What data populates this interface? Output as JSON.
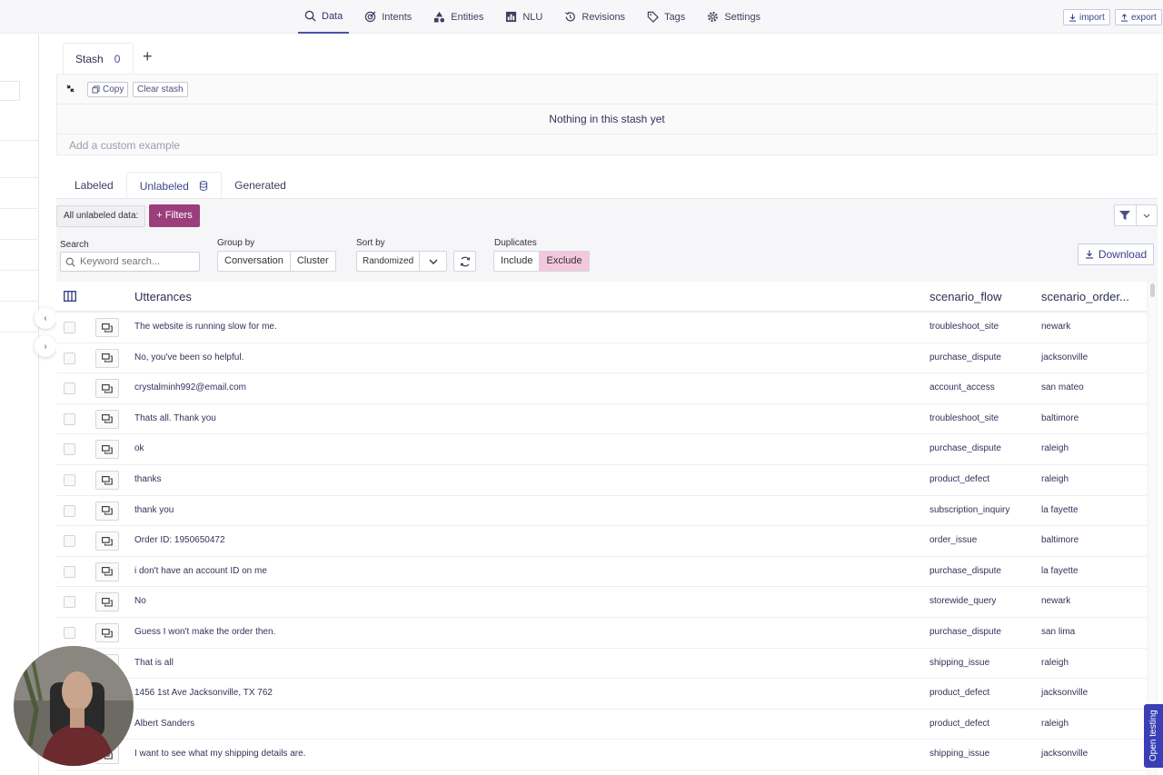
{
  "nav": {
    "items": [
      {
        "label": "Data",
        "icon": "search-icon",
        "active": true
      },
      {
        "label": "Intents",
        "icon": "target-icon"
      },
      {
        "label": "Entities",
        "icon": "shapes-icon"
      },
      {
        "label": "NLU",
        "icon": "bar-chart-icon"
      },
      {
        "label": "Revisions",
        "icon": "history-icon"
      },
      {
        "label": "Tags",
        "icon": "tag-icon"
      },
      {
        "label": "Settings",
        "icon": "gear-icon"
      }
    ],
    "import_label": "import",
    "export_label": "export"
  },
  "stash": {
    "tab_label": "Stash",
    "count": "0",
    "copy_label": "Copy",
    "clear_label": "Clear stash",
    "empty_text": "Nothing in this stash yet",
    "custom_placeholder": "Add a custom example"
  },
  "data_tabs": {
    "labeled": "Labeled",
    "unlabeled": "Unlabeled",
    "generated": "Generated"
  },
  "toolbar": {
    "all_data_label": "All unlabeled data:",
    "filters_label": "+ Filters",
    "search_label": "Search",
    "search_placeholder": "Keyword search...",
    "group_by_label": "Group by",
    "group_options": [
      "Conversation",
      "Cluster"
    ],
    "sort_by_label": "Sort by",
    "sort_value": "Randomized",
    "duplicates_label": "Duplicates",
    "dup_include": "Include",
    "dup_exclude": "Exclude",
    "download_label": "Download"
  },
  "table": {
    "columns": {
      "utterances": "Utterances",
      "flow": "scenario_flow",
      "order": "scenario_order..."
    },
    "rows": [
      {
        "utterance": "The website is running slow for me.",
        "flow": "troubleshoot_site",
        "order": "newark"
      },
      {
        "utterance": "No, you've been so helpful.",
        "flow": "purchase_dispute",
        "order": "jacksonville"
      },
      {
        "utterance": "crystalminh992@email.com",
        "flow": "account_access",
        "order": "san mateo"
      },
      {
        "utterance": "Thats all. Thank you",
        "flow": "troubleshoot_site",
        "order": "baltimore"
      },
      {
        "utterance": "ok",
        "flow": "purchase_dispute",
        "order": "raleigh"
      },
      {
        "utterance": "thanks",
        "flow": "product_defect",
        "order": "raleigh"
      },
      {
        "utterance": "thank you",
        "flow": "subscription_inquiry",
        "order": "la fayette"
      },
      {
        "utterance": "Order ID: 1950650472",
        "flow": "order_issue",
        "order": "baltimore"
      },
      {
        "utterance": "i don't have an account ID on me",
        "flow": "purchase_dispute",
        "order": "la fayette"
      },
      {
        "utterance": "No",
        "flow": "storewide_query",
        "order": "newark"
      },
      {
        "utterance": "Guess I won't make the order then.",
        "flow": "purchase_dispute",
        "order": "san lima"
      },
      {
        "utterance": "That is all",
        "flow": "shipping_issue",
        "order": "raleigh"
      },
      {
        "utterance": "1456 1st Ave Jacksonville, TX 762",
        "flow": "product_defect",
        "order": "jacksonville"
      },
      {
        "utterance": "Albert Sanders",
        "flow": "product_defect",
        "order": "raleigh"
      },
      {
        "utterance": "I want to see what my shipping details are.",
        "flow": "shipping_issue",
        "order": "jacksonville"
      }
    ]
  },
  "open_testing_label": "Open testing",
  "colors": {
    "accent": "#4d52a8",
    "filters": "#9b3f7c",
    "exclude_selected": "#f3c8dc",
    "open_testing": "#3a3fb5"
  }
}
